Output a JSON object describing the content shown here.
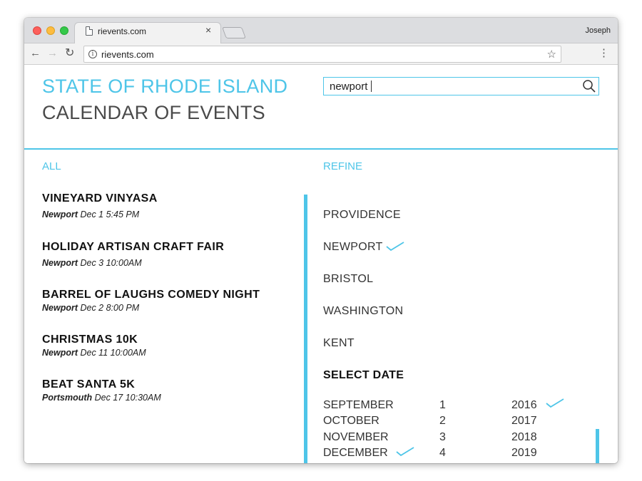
{
  "browser": {
    "tab_title": "rievents.com",
    "tab_close": "×",
    "user": "Joseph",
    "url": "rievents.com"
  },
  "header": {
    "title_line1": "STATE OF RHODE ISLAND",
    "title_line2": "CALENDAR OF EVENTS",
    "search_value": "newport"
  },
  "labels": {
    "all": "ALL",
    "refine": "REFINE",
    "select_date": "SELECT DATE"
  },
  "events": [
    {
      "title": "VINEYARD VINYASA",
      "location": "Newport",
      "date": "Dec 1",
      "time": "5:45 PM"
    },
    {
      "title": "HOLIDAY ARTISAN CRAFT FAIR",
      "location": "Newport",
      "date": "Dec 3",
      "time": "10:00AM"
    },
    {
      "title": "BARREL OF LAUGHS COMEDY NIGHT",
      "location": "Newport",
      "date": "Dec 2",
      "time": "8:00 PM"
    },
    {
      "title": "CHRISTMAS 10K",
      "location": "Newport",
      "date": "Dec 11",
      "time": "10:00AM"
    },
    {
      "title": "BEAT SANTA 5K",
      "location": "Portsmouth",
      "date": "Dec 17",
      "time": "10:30AM"
    }
  ],
  "regions": [
    {
      "name": "PROVIDENCE",
      "checked": false
    },
    {
      "name": "NEWPORT",
      "checked": true
    },
    {
      "name": "BRISTOL",
      "checked": false
    },
    {
      "name": "WASHINGTON",
      "checked": false
    },
    {
      "name": "KENT",
      "checked": false
    }
  ],
  "months": [
    "SEPTEMBER",
    "OCTOBER",
    "NOVEMBER",
    "DECEMBER"
  ],
  "month_selected": "DECEMBER",
  "days": [
    "1",
    "2",
    "3",
    "4"
  ],
  "years": [
    "2016",
    "2017",
    "2018",
    "2019"
  ],
  "year_selected": "2016",
  "colors": {
    "accent": "#4ec5e8",
    "text": "#333333"
  },
  "icons": [
    "document-icon",
    "info-icon",
    "star-icon",
    "menu-icon",
    "search-icon",
    "check-icon"
  ]
}
